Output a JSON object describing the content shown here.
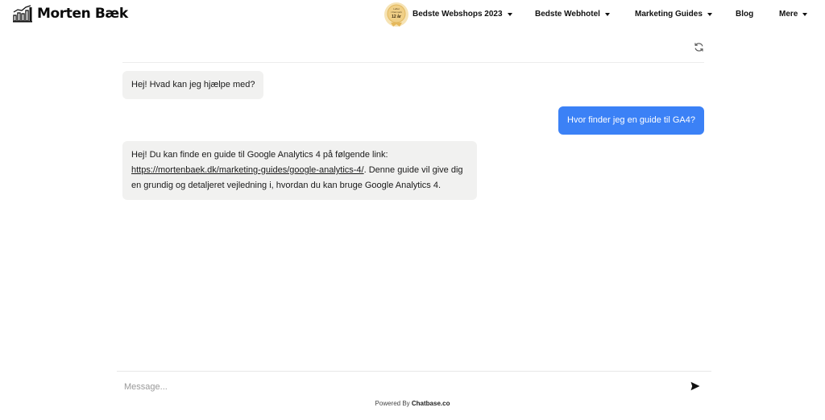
{
  "header": {
    "logo_text": "Morten Bæk",
    "badge": {
      "line1": "Løftet",
      "line2": "i Danmark",
      "line3": "12 år"
    },
    "nav": [
      {
        "label": "Bedste Webshops 2023",
        "has_dropdown": true
      },
      {
        "label": "Bedste Webhotel",
        "has_dropdown": true
      },
      {
        "label": "Marketing Guides",
        "has_dropdown": true
      },
      {
        "label": "Blog",
        "has_dropdown": false
      },
      {
        "label": "Mere",
        "has_dropdown": true
      }
    ]
  },
  "chat": {
    "messages": [
      {
        "role": "bot",
        "text": "Hej! Hvad kan jeg hjælpe med?"
      },
      {
        "role": "user",
        "text": "Hvor finder jeg en guide til GA4?"
      },
      {
        "role": "bot",
        "text_before": "Hej! Du kan finde en guide til Google Analytics 4 på følgende link: ",
        "link": "https://mortenbaek.dk/marketing-guides/google-analytics-4/",
        "text_after": ". Denne guide vil give dig en grundig og detaljeret vejledning i, hvordan du kan bruge Google Analytics 4."
      }
    ],
    "input": {
      "placeholder": "Message...",
      "value": ""
    },
    "footer": {
      "prefix": "Powered By ",
      "brand": "Chatbase.co"
    }
  },
  "colors": {
    "user_bubble": "#3b81f6",
    "bot_bubble": "#f1f1f0",
    "badge": "#f0cf86"
  },
  "icons": {
    "refresh": "refresh-icon",
    "send": "send-icon",
    "logo": "bar-chart-logo-icon"
  }
}
